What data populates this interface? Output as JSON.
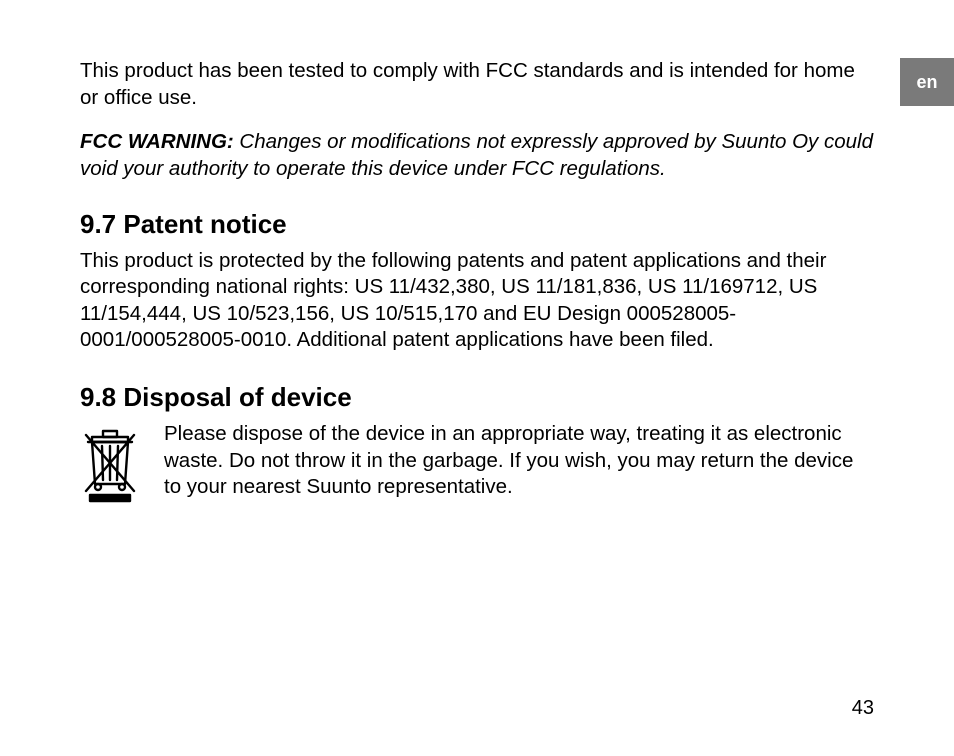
{
  "lang_tab": "en",
  "intro_para": "This product has been tested to comply with FCC standards and is intended for home or office use.",
  "fcc_warning_label": "FCC WARNING:",
  "fcc_warning_body": " Changes or modifications not expressly approved by Suunto Oy could void your authority to operate this device under FCC regulations.",
  "section_97_heading": "9.7  Patent notice",
  "section_97_body": "This product is protected by the following patents and patent applications and their corresponding national rights: US 11/432,380, US 11/181,836, US 11/169712, US 11/154,444, US 10/523,156, US 10/515,170 and EU Design 000528005-0001/000528005-0010. Additional patent applications have been filed.",
  "section_98_heading": "9.8  Disposal of device",
  "section_98_body": "Please dispose of the device in an appropriate way, treating it as electronic waste. Do not throw it in the garbage. If you wish, you may return the device to your nearest Suunto representative.",
  "page_number": "43"
}
